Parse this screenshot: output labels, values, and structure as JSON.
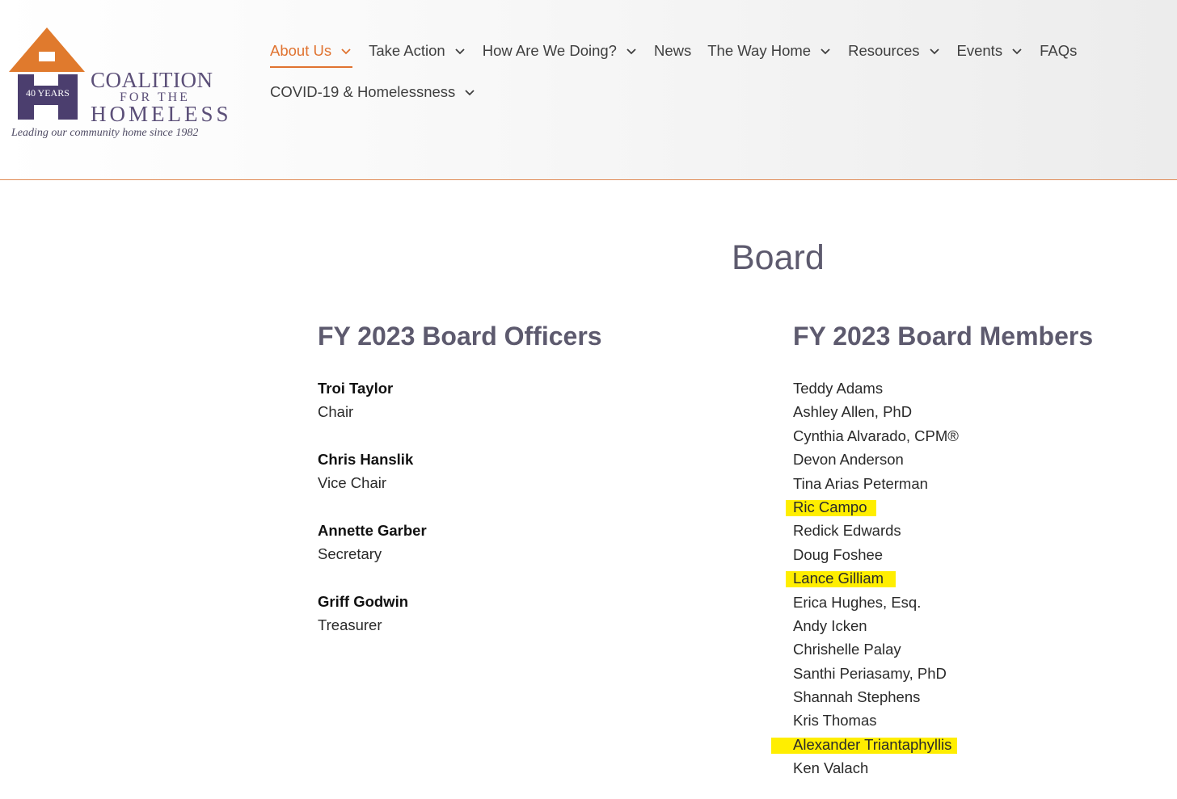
{
  "colors": {
    "accent": "#e07330",
    "heading": "#5d5a6e",
    "logo_purple": "#4b3e6e",
    "logo_orange": "#e07a2d",
    "highlight": "#ffee00"
  },
  "logo": {
    "years": "40 YEARS",
    "line1": "COALITION",
    "line2": "FOR THE",
    "line3": "HOMELESS",
    "tagline": "Leading our community home since 1982"
  },
  "nav": {
    "items": [
      {
        "label": "About Us",
        "dropdown": true,
        "active": true
      },
      {
        "label": "Take Action",
        "dropdown": true
      },
      {
        "label": "How Are We Doing?",
        "dropdown": true
      },
      {
        "label": "News",
        "dropdown": false
      },
      {
        "label": "The Way Home",
        "dropdown": true
      },
      {
        "label": "Resources",
        "dropdown": true
      },
      {
        "label": "Events",
        "dropdown": true
      },
      {
        "label": "FAQs",
        "dropdown": false
      },
      {
        "label": "COVID-19 & Homelessness",
        "dropdown": true
      }
    ]
  },
  "page": {
    "title": "Board",
    "officers_heading": "FY 2023 Board Officers",
    "members_heading": "FY 2023 Board Members"
  },
  "officers": [
    {
      "name": "Troi Taylor",
      "role": "Chair"
    },
    {
      "name": "Chris Hanslik",
      "role": "Vice Chair"
    },
    {
      "name": "Annette Garber",
      "role": "Secretary"
    },
    {
      "name": "Griff Godwin",
      "role": "Treasurer"
    }
  ],
  "members": [
    {
      "name": "Teddy Adams",
      "highlighted": false
    },
    {
      "name": "Ashley Allen, PhD",
      "highlighted": false
    },
    {
      "name": "Cynthia Alvarado, CPM®",
      "highlighted": false
    },
    {
      "name": "Devon Anderson",
      "highlighted": false
    },
    {
      "name": "Tina Arias Peterman",
      "highlighted": false
    },
    {
      "name": "Ric Campo",
      "highlighted": true
    },
    {
      "name": "Redick Edwards",
      "highlighted": false
    },
    {
      "name": "Doug Foshee",
      "highlighted": false
    },
    {
      "name": "Lance Gilliam",
      "highlighted": true
    },
    {
      "name": "Erica Hughes, Esq.",
      "highlighted": false
    },
    {
      "name": "Andy Icken",
      "highlighted": false
    },
    {
      "name": "Chrishelle Palay",
      "highlighted": false
    },
    {
      "name": "Santhi Periasamy, PhD",
      "highlighted": false
    },
    {
      "name": "Shannah Stephens",
      "highlighted": false
    },
    {
      "name": "Kris Thomas",
      "highlighted": false
    },
    {
      "name": "Alexander Triantaphyllis",
      "highlighted": true
    },
    {
      "name": "Ken Valach",
      "highlighted": false
    }
  ]
}
